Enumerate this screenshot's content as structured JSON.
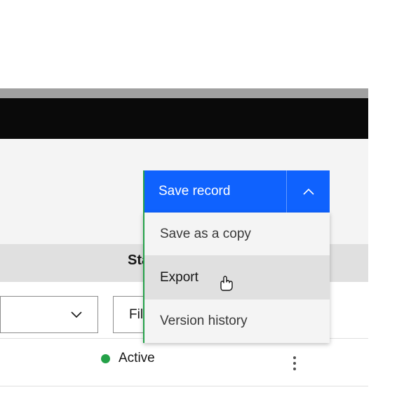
{
  "colors": {
    "primary": "#0f62fe",
    "accent": "#24a148"
  },
  "split_button": {
    "main_label": "Save record"
  },
  "menu": {
    "items": [
      {
        "label": "Save as a copy"
      },
      {
        "label": "Export"
      },
      {
        "label": "Version history"
      }
    ],
    "hovered_index": 1
  },
  "columns": {
    "status_header": "Sta"
  },
  "filter": {
    "placeholder_fragment": "Fil"
  },
  "row": {
    "status_label": "Active"
  }
}
